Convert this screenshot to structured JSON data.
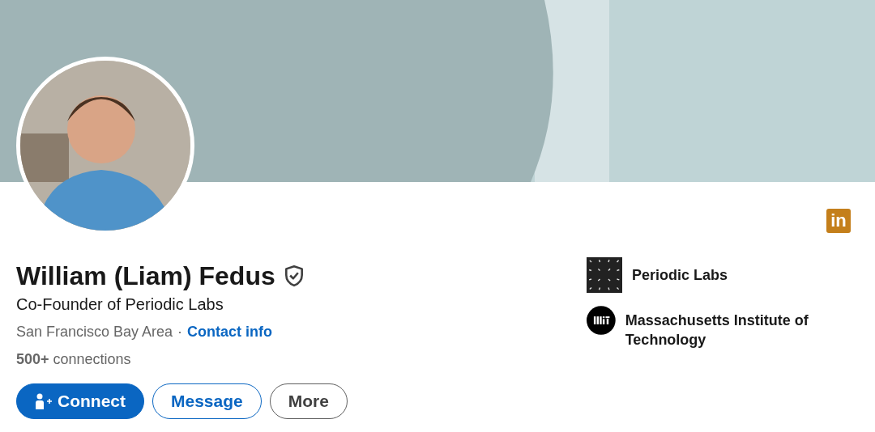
{
  "profile": {
    "name": "William (Liam) Fedus",
    "verified": true,
    "headline": "Co-Founder of Periodic Labs",
    "location": "San Francisco Bay Area",
    "separator": "·",
    "contact_link": "Contact info",
    "connections_count": "500+",
    "connections_label": "connections"
  },
  "buttons": [
    {
      "label": "Connect",
      "kind": "primary"
    },
    {
      "label": "Message",
      "kind": "outline"
    },
    {
      "label": "More",
      "kind": "neutral"
    }
  ],
  "badge": {
    "text": "in"
  },
  "companies": [
    {
      "name": "Periodic Labs",
      "kind": "grid"
    },
    {
      "name": "Massachusetts Institute of Technology",
      "kind": "round"
    }
  ]
}
